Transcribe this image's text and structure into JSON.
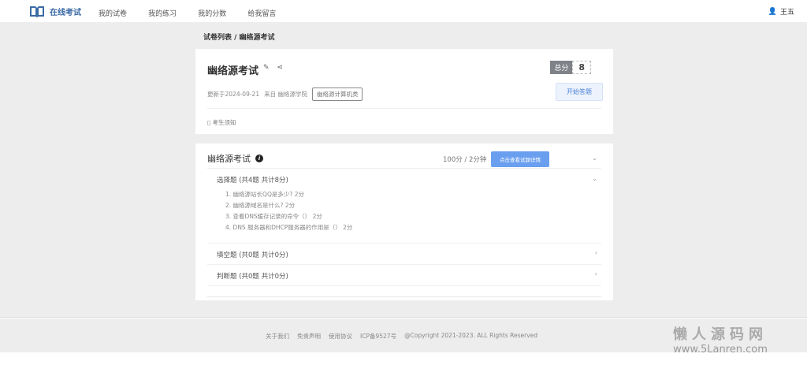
{
  "header": {
    "brand": "在线考试",
    "nav": [
      "我的试卷",
      "我的练习",
      "我的分数",
      "给我留言"
    ],
    "user": "王五"
  },
  "breadcrumb": "试卷列表 / 幽络源考试",
  "exam": {
    "title": "幽络源考试",
    "score_label": "总分",
    "score": "8",
    "updated": "更新于2024-09-21",
    "source": "来自 幽络源学院",
    "tag": "幽络源计算机类",
    "start": "开始答题",
    "notice": "考生须知"
  },
  "paper": {
    "title": "幽络源考试",
    "duration": "100分 / 2分钟",
    "detail": "点击查看试题详情",
    "sections": [
      {
        "label": "选择题 (共4题 共计8分)",
        "questions": [
          "1. 幽络源站长QQ是多少?  2分",
          "2. 幽络源域名是什么? 2分",
          "3. 查看DNS缓存记录的命令（） 2分",
          "4. DNS 服务器和DHCP服务器的作用是（） 2分"
        ]
      },
      {
        "label": "填空题 (共0题 共计0分)"
      },
      {
        "label": "判断题 (共0题 共计0分)"
      }
    ]
  },
  "footer": {
    "links": [
      "关于我们",
      "免责声明",
      "使用协议",
      "ICP备9527号",
      "@Copyright 2021-2023. ALL Rights Reserved"
    ]
  },
  "watermark": {
    "name": "懒人源码网",
    "url": "www.5Lanren.com"
  }
}
